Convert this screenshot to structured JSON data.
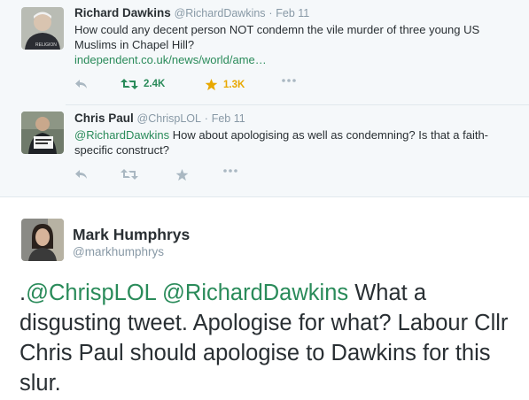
{
  "colors": {
    "link": "#2a8b5a",
    "retweet": "#2a8b5a",
    "favorite": "#e8a800",
    "muted": "#8899a6"
  },
  "tweets": [
    {
      "name": "Richard Dawkins",
      "handle": "@RichardDawkins",
      "date": "Feb 11",
      "text": "How could any decent person NOT condemn the vile murder of three young US Muslims in Chapel Hill?",
      "link": "independent.co.uk/news/world/ame…",
      "retweets": "2.4K",
      "favorites": "1.3K",
      "icons": [
        "reply-icon",
        "retweet-icon",
        "star-icon",
        "more-icon"
      ]
    },
    {
      "name": "Chris Paul",
      "handle": "@ChrispLOL",
      "date": "Feb 11",
      "mention": "@RichardDawkins",
      "text": " How about apologising as well as condemning? Is that a faith-specific construct?",
      "icons": [
        "reply-icon",
        "retweet-icon",
        "star-icon",
        "more-icon"
      ]
    }
  ],
  "main": {
    "name": "Mark Humphrys",
    "handle": "@markhumphrys",
    "prefix": ".",
    "mention1": "@ChrispLOL",
    "mention2": "@RichardDawkins",
    "text": "  What a disgusting tweet. Apologise for what? Labour Cllr Chris Paul should apologise to Dawkins for this slur."
  }
}
